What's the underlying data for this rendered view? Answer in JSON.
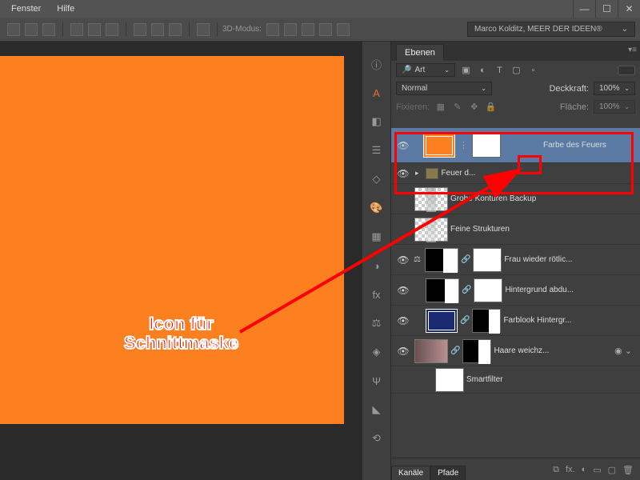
{
  "menu": {
    "fenster": "Fenster",
    "hilfe": "Hilfe"
  },
  "toolbar": {
    "mode3d": "3D-Modus:",
    "user": "Marco Kolditz, MEER DER IDEEN®"
  },
  "panel": {
    "tab": "Ebenen",
    "search_label": "Art",
    "blend_mode": "Normal",
    "opacity_label": "Deckkraft:",
    "opacity_value": "100%",
    "lock_label": "Fixieren:",
    "fill_label": "Fläche:",
    "fill_value": "100%"
  },
  "layers": [
    {
      "name": "Farbe des Feuers",
      "kind": "fill-orange",
      "selected": true,
      "mask": true
    },
    {
      "name": "Feuer d...",
      "kind": "folder"
    },
    {
      "name": "Grobe Konturen Backup",
      "kind": "checker-smoke"
    },
    {
      "name": "Feine Strukturen",
      "kind": "checker-smoke"
    },
    {
      "name": "Frau wieder rötlic...",
      "kind": "silhouette",
      "mask": true,
      "link": true
    },
    {
      "name": "Hintergrund abdu...",
      "kind": "silhouette",
      "mask": true,
      "link": true
    },
    {
      "name": "Farblook Hintergr...",
      "kind": "fill-blue",
      "mask": true,
      "link": true,
      "maskKind": "silhouette"
    },
    {
      "name": "Haare weichz...",
      "kind": "couple",
      "mask": true,
      "link": true,
      "maskKind": "silhouette",
      "extra": true
    },
    {
      "name": "Smartfilter",
      "kind": "smartfilter"
    }
  ],
  "bottom": {
    "kanale": "Kanäle",
    "pfade": "Pfade"
  },
  "annotation": {
    "line1": "Icon für",
    "line2": "Schnittmaske"
  }
}
